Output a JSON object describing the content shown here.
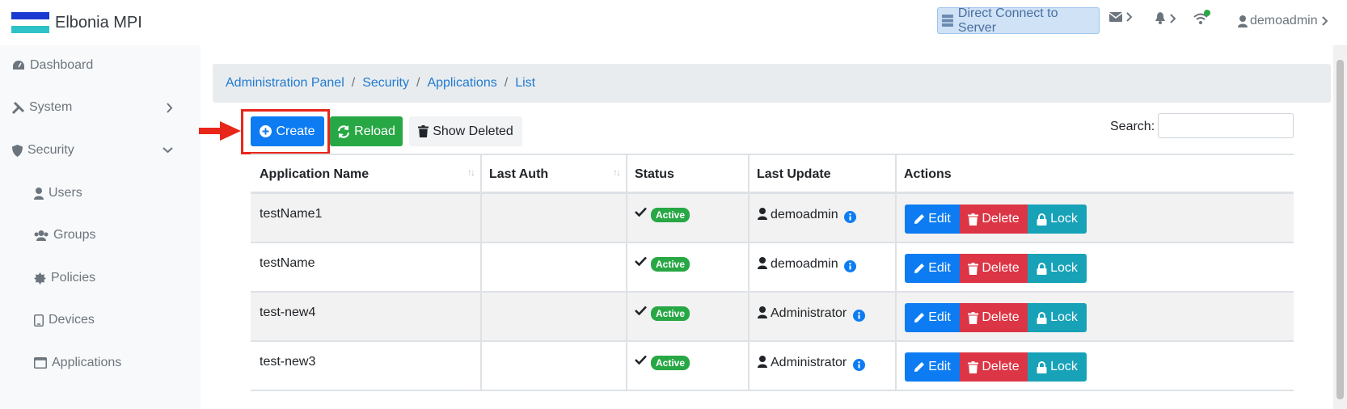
{
  "brand": {
    "name": "Elbonia MPI",
    "flag_colors": [
      "#1a3ad1",
      "#ffffff",
      "#2cc2c8"
    ]
  },
  "topbar": {
    "direct_connect_label": "Direct Connect to Server",
    "user_label": "demoadmin",
    "status_dot_color": "#28a745"
  },
  "sidebar": {
    "items": [
      {
        "label": "Dashboard"
      },
      {
        "label": "System"
      },
      {
        "label": "Security"
      }
    ],
    "sub_items": [
      {
        "label": "Users"
      },
      {
        "label": "Groups"
      },
      {
        "label": "Policies"
      },
      {
        "label": "Devices"
      },
      {
        "label": "Applications"
      }
    ]
  },
  "breadcrumb": [
    "Administration Panel",
    "Security",
    "Applications",
    "List"
  ],
  "toolbar": {
    "create_label": "Create",
    "reload_label": "Reload",
    "show_deleted_label": "Show Deleted",
    "search_label": "Search:",
    "search_value": ""
  },
  "table": {
    "headers": [
      "Application Name",
      "Last Auth",
      "Status",
      "Last Update",
      "Actions"
    ],
    "rows": [
      {
        "name": "testName1",
        "last_auth": "",
        "status": "Active",
        "updated_by": "demoadmin"
      },
      {
        "name": "testName",
        "last_auth": "",
        "status": "Active",
        "updated_by": "demoadmin"
      },
      {
        "name": "test-new4",
        "last_auth": "",
        "status": "Active",
        "updated_by": "Administrator"
      },
      {
        "name": "test-new3",
        "last_auth": "",
        "status": "Active",
        "updated_by": "Administrator"
      }
    ],
    "actions": {
      "edit": "Edit",
      "delete": "Delete",
      "lock": "Lock"
    }
  },
  "colors": {
    "primary": "#0d7cf2",
    "success": "#28a745",
    "danger": "#dc3545",
    "info": "#17a2b8",
    "highlight": "#e8261a"
  }
}
